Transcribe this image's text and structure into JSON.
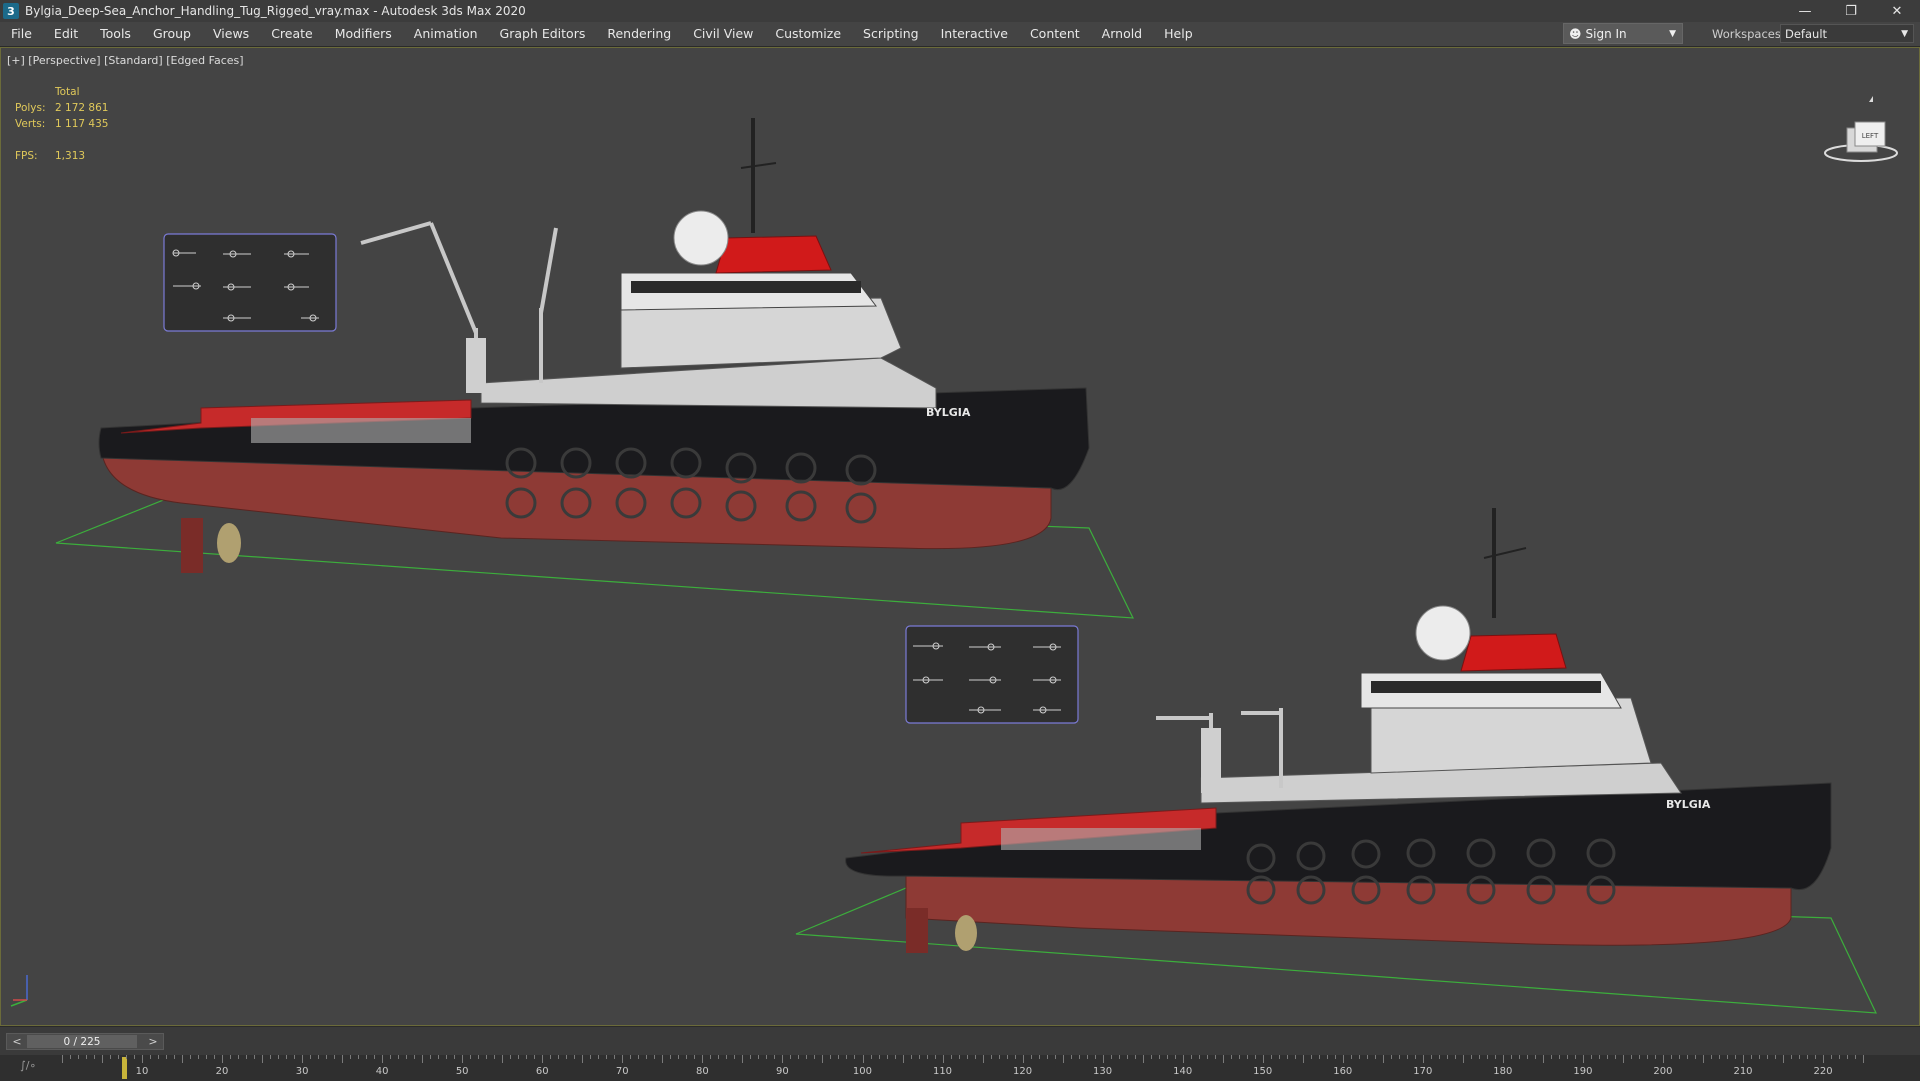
{
  "window": {
    "title": "Bylgia_Deep-Sea_Anchor_Handling_Tug_Rigged_vray.max - Autodesk 3ds Max 2020",
    "app_icon_label": "3"
  },
  "menu": {
    "items": [
      "File",
      "Edit",
      "Tools",
      "Group",
      "Views",
      "Create",
      "Modifiers",
      "Animation",
      "Graph Editors",
      "Rendering",
      "Civil View",
      "Customize",
      "Scripting",
      "Interactive",
      "Content",
      "Arnold",
      "Help"
    ],
    "sign_in": "Sign In",
    "workspaces_label": "Workspaces:",
    "workspace_value": "Default"
  },
  "viewport": {
    "label": "[+] [Perspective] [Standard] [Edged Faces]",
    "stats": {
      "header": "Total",
      "polys_label": "Polys:",
      "polys_value": "2 172 861",
      "verts_label": "Verts:",
      "verts_value": "1 117 435",
      "fps_label": "FPS:",
      "fps_value": "1,313"
    },
    "viewcube_label": "LEFT",
    "ship_name": "BYLGIA",
    "colors": {
      "hull_red": "#8e3a35",
      "hull_black": "#1a1a1d",
      "accent_red": "#d11a1a",
      "ground_line": "#3cae3c",
      "control_panel": "#7b7bd6"
    }
  },
  "timeline": {
    "frame_text": "0 / 225",
    "ticks": [
      "10",
      "20",
      "30",
      "40",
      "50",
      "60",
      "70",
      "80",
      "90",
      "100",
      "110",
      "120",
      "130",
      "140",
      "150",
      "160",
      "170",
      "180",
      "190",
      "200",
      "210",
      "220"
    ]
  }
}
